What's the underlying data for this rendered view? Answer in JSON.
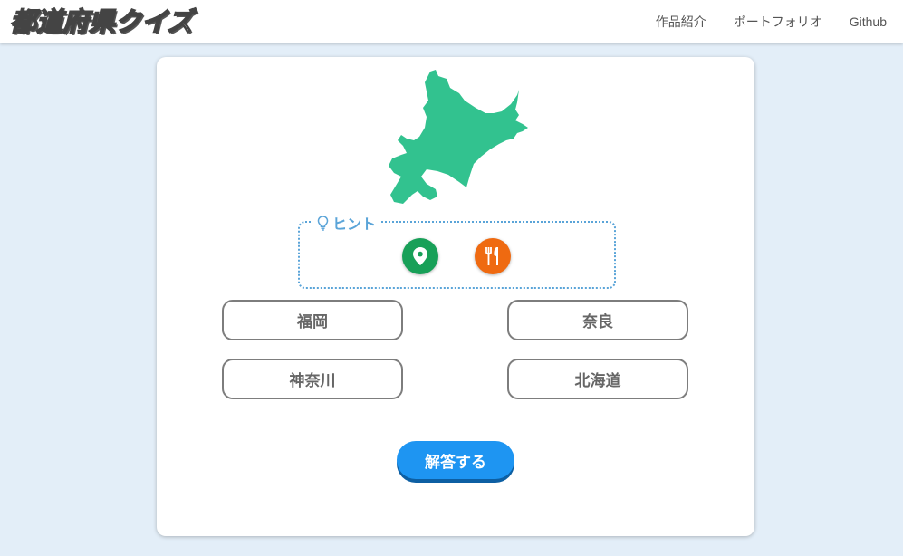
{
  "header": {
    "logo": {
      "part1": "都",
      "part2": "道",
      "part3": "府県クイズ"
    },
    "nav": [
      "作品紹介",
      "ポートフォリオ",
      "Github"
    ]
  },
  "quiz": {
    "map_color": "#32c28f",
    "hint": {
      "label": "ヒント",
      "buttons": [
        "location-pin-icon",
        "fork-knife-icon"
      ]
    },
    "choices": [
      "福岡",
      "奈良",
      "神奈川",
      "北海道"
    ],
    "answer_label": "解答する"
  }
}
